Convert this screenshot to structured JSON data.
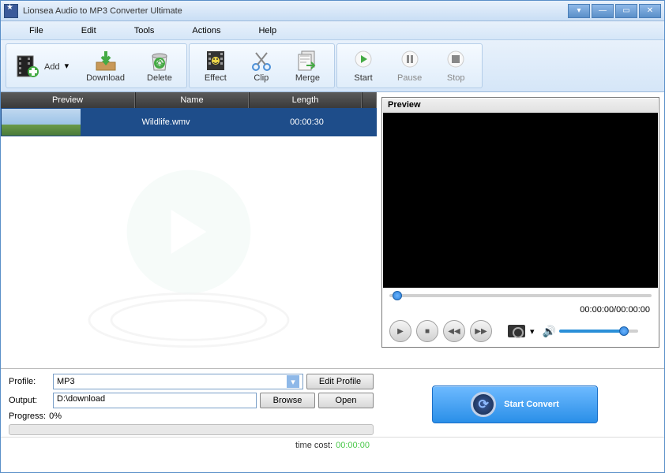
{
  "title": "Lionsea Audio to MP3 Converter Ultimate",
  "menu": {
    "file": "File",
    "edit": "Edit",
    "tools": "Tools",
    "actions": "Actions",
    "help": "Help"
  },
  "toolbar": {
    "add": "Add",
    "download": "Download",
    "delete": "Delete",
    "effect": "Effect",
    "clip": "Clip",
    "merge": "Merge",
    "start": "Start",
    "pause": "Pause",
    "stop": "Stop"
  },
  "list": {
    "headers": {
      "preview": "Preview",
      "name": "Name",
      "length": "Length"
    },
    "rows": [
      {
        "name": "Wildlife.wmv",
        "length": "00:00:30"
      }
    ]
  },
  "preview": {
    "label": "Preview",
    "time": "00:00:00/00:00:00"
  },
  "form": {
    "profile_label": "Profile:",
    "profile_value": "MP3",
    "edit_profile": "Edit Profile",
    "output_label": "Output:",
    "output_value": "D:\\download",
    "browse": "Browse",
    "open": "Open",
    "progress_label": "Progress:",
    "progress_value": "0%"
  },
  "convert": {
    "label": "Start Convert"
  },
  "status": {
    "label": "time cost:",
    "value": "00:00:00"
  }
}
